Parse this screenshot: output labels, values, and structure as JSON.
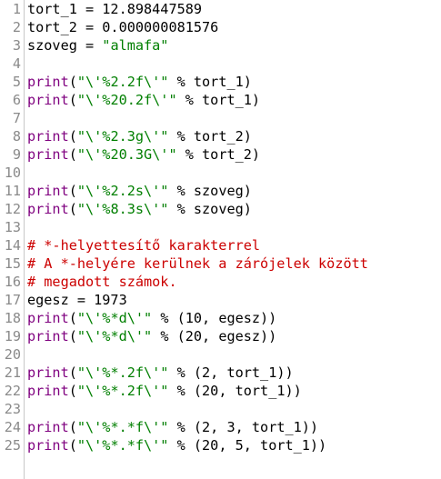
{
  "colors": {
    "keyword": "#7f007f",
    "string": "#007f00",
    "comment": "#cc0000",
    "plain": "#000000",
    "line_number": "#8a8a8a"
  },
  "lines": [
    {
      "num": "1",
      "tokens": [
        {
          "t": "plain",
          "v": "tort_1 = 12.898447589"
        }
      ]
    },
    {
      "num": "2",
      "tokens": [
        {
          "t": "plain",
          "v": "tort_2 = 0.000000081576"
        }
      ]
    },
    {
      "num": "3",
      "tokens": [
        {
          "t": "plain",
          "v": "szoveg = "
        },
        {
          "t": "str",
          "v": "\"almafa\""
        }
      ]
    },
    {
      "num": "4",
      "tokens": []
    },
    {
      "num": "5",
      "tokens": [
        {
          "t": "kw",
          "v": "print"
        },
        {
          "t": "plain",
          "v": "("
        },
        {
          "t": "str",
          "v": "\"\\'%2.2f\\'\""
        },
        {
          "t": "plain",
          "v": " % tort_1)"
        }
      ]
    },
    {
      "num": "6",
      "tokens": [
        {
          "t": "kw",
          "v": "print"
        },
        {
          "t": "plain",
          "v": "("
        },
        {
          "t": "str",
          "v": "\"\\'%20.2f\\'\""
        },
        {
          "t": "plain",
          "v": " % tort_1)"
        }
      ]
    },
    {
      "num": "7",
      "tokens": []
    },
    {
      "num": "8",
      "tokens": [
        {
          "t": "kw",
          "v": "print"
        },
        {
          "t": "plain",
          "v": "("
        },
        {
          "t": "str",
          "v": "\"\\'%2.3g\\'\""
        },
        {
          "t": "plain",
          "v": " % tort_2)"
        }
      ]
    },
    {
      "num": "9",
      "tokens": [
        {
          "t": "kw",
          "v": "print"
        },
        {
          "t": "plain",
          "v": "("
        },
        {
          "t": "str",
          "v": "\"\\'%20.3G\\'\""
        },
        {
          "t": "plain",
          "v": " % tort_2)"
        }
      ]
    },
    {
      "num": "10",
      "tokens": []
    },
    {
      "num": "11",
      "tokens": [
        {
          "t": "kw",
          "v": "print"
        },
        {
          "t": "plain",
          "v": "("
        },
        {
          "t": "str",
          "v": "\"\\'%2.2s\\'\""
        },
        {
          "t": "plain",
          "v": " % szoveg)"
        }
      ]
    },
    {
      "num": "12",
      "tokens": [
        {
          "t": "kw",
          "v": "print"
        },
        {
          "t": "plain",
          "v": "("
        },
        {
          "t": "str",
          "v": "\"\\'%8.3s\\'\""
        },
        {
          "t": "plain",
          "v": " % szoveg)"
        }
      ]
    },
    {
      "num": "13",
      "tokens": []
    },
    {
      "num": "14",
      "tokens": [
        {
          "t": "cmt",
          "v": "# *-helyettesítő karakterrel"
        }
      ]
    },
    {
      "num": "15",
      "tokens": [
        {
          "t": "cmt",
          "v": "# A *-helyére kerülnek a zárójelek között"
        }
      ]
    },
    {
      "num": "16",
      "tokens": [
        {
          "t": "cmt",
          "v": "# megadott számok."
        }
      ]
    },
    {
      "num": "17",
      "tokens": [
        {
          "t": "plain",
          "v": "egesz = 1973"
        }
      ]
    },
    {
      "num": "18",
      "tokens": [
        {
          "t": "kw",
          "v": "print"
        },
        {
          "t": "plain",
          "v": "("
        },
        {
          "t": "str",
          "v": "\"\\'%*d\\'\""
        },
        {
          "t": "plain",
          "v": " % (10, egesz))"
        }
      ]
    },
    {
      "num": "19",
      "tokens": [
        {
          "t": "kw",
          "v": "print"
        },
        {
          "t": "plain",
          "v": "("
        },
        {
          "t": "str",
          "v": "\"\\'%*d\\'\""
        },
        {
          "t": "plain",
          "v": " % (20, egesz))"
        }
      ]
    },
    {
      "num": "20",
      "tokens": []
    },
    {
      "num": "21",
      "tokens": [
        {
          "t": "kw",
          "v": "print"
        },
        {
          "t": "plain",
          "v": "("
        },
        {
          "t": "str",
          "v": "\"\\'%*.2f\\'\""
        },
        {
          "t": "plain",
          "v": " % (2, tort_1))"
        }
      ]
    },
    {
      "num": "22",
      "tokens": [
        {
          "t": "kw",
          "v": "print"
        },
        {
          "t": "plain",
          "v": "("
        },
        {
          "t": "str",
          "v": "\"\\'%*.2f\\'\""
        },
        {
          "t": "plain",
          "v": " % (20, tort_1))"
        }
      ]
    },
    {
      "num": "23",
      "tokens": []
    },
    {
      "num": "24",
      "tokens": [
        {
          "t": "kw",
          "v": "print"
        },
        {
          "t": "plain",
          "v": "("
        },
        {
          "t": "str",
          "v": "\"\\'%*.*f\\'\""
        },
        {
          "t": "plain",
          "v": " % (2, 3, tort_1))"
        }
      ]
    },
    {
      "num": "25",
      "tokens": [
        {
          "t": "kw",
          "v": "print"
        },
        {
          "t": "plain",
          "v": "("
        },
        {
          "t": "str",
          "v": "\"\\'%*.*f\\'\""
        },
        {
          "t": "plain",
          "v": " % (20, 5, tort_1))"
        }
      ]
    }
  ]
}
